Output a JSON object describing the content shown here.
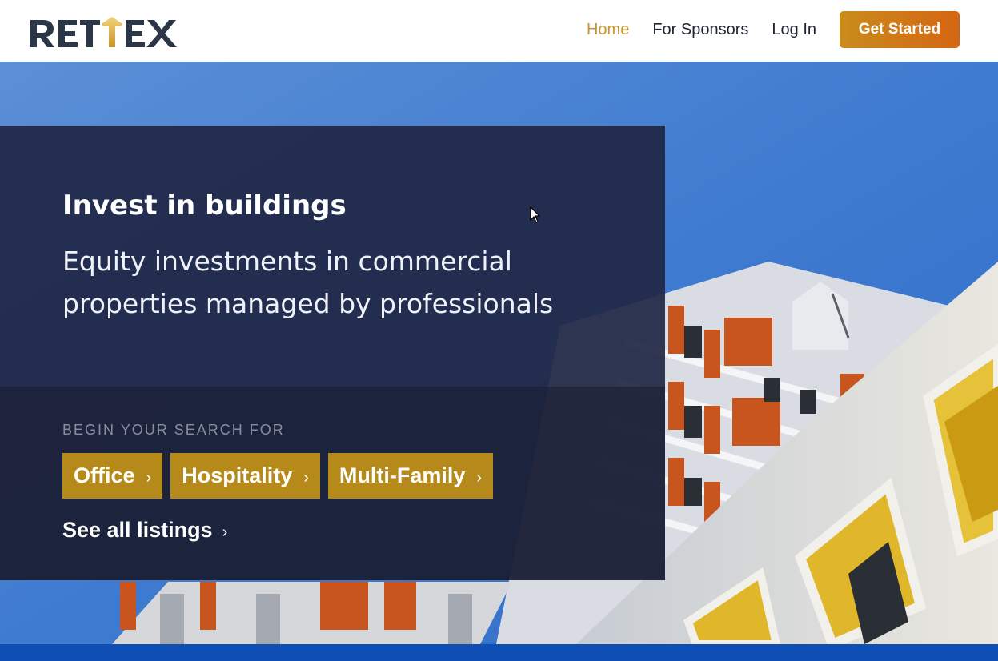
{
  "logo": {
    "name": "RETTEX"
  },
  "nav": {
    "links": [
      "Home",
      "For Sponsors",
      "Log In"
    ],
    "active": "Home",
    "cta_label": "Get Started"
  },
  "hero": {
    "title": "Invest in buildings",
    "subtitle": "Equity investments in commercial properties managed by professionals",
    "search_label": "BEGIN YOUR SEARCH FOR",
    "categories": [
      "Office",
      "Hospitality",
      "Multi-Family"
    ],
    "see_all": "See all listings",
    "chevron": "›"
  },
  "colors": {
    "accent": "#c8952c",
    "cta_start": "#c98c1c",
    "cta_end": "#d56512",
    "category_bg": "#b58a1b",
    "panel": "#1f2644",
    "brand_text": "#2b3649"
  }
}
